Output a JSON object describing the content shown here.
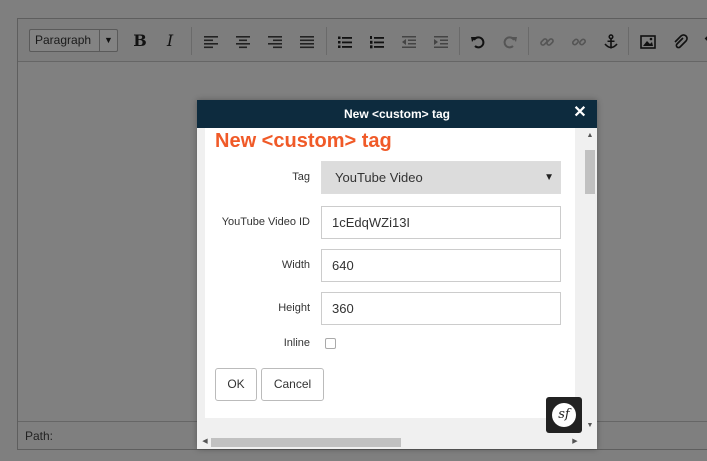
{
  "toolbar": {
    "format_select": "Paragraph",
    "buttons": [
      "bold",
      "italic",
      "align-left",
      "align-center",
      "align-right",
      "align-justify",
      "bullet-list",
      "numbered-list",
      "outdent",
      "indent",
      "undo",
      "redo",
      "link",
      "unlink",
      "anchor",
      "image",
      "attachment"
    ]
  },
  "statusbar": {
    "path_label": "Path:"
  },
  "dialog": {
    "title": "New <custom> tag",
    "heading": "New <custom> tag",
    "fields": {
      "tag_label": "Tag",
      "tag_value": "YouTube Video",
      "video_id_label": "YouTube Video ID",
      "video_id_value": "1cEdqWZi13I",
      "width_label": "Width",
      "width_value": "640",
      "height_label": "Height",
      "height_value": "360",
      "inline_label": "Inline"
    },
    "ok_label": "OK",
    "cancel_label": "Cancel"
  },
  "badge": {
    "glyph": "sf"
  },
  "colors": {
    "title_bar": "#0d2b3e",
    "heading": "#f05a28",
    "overlay": "#7f7f7f"
  }
}
